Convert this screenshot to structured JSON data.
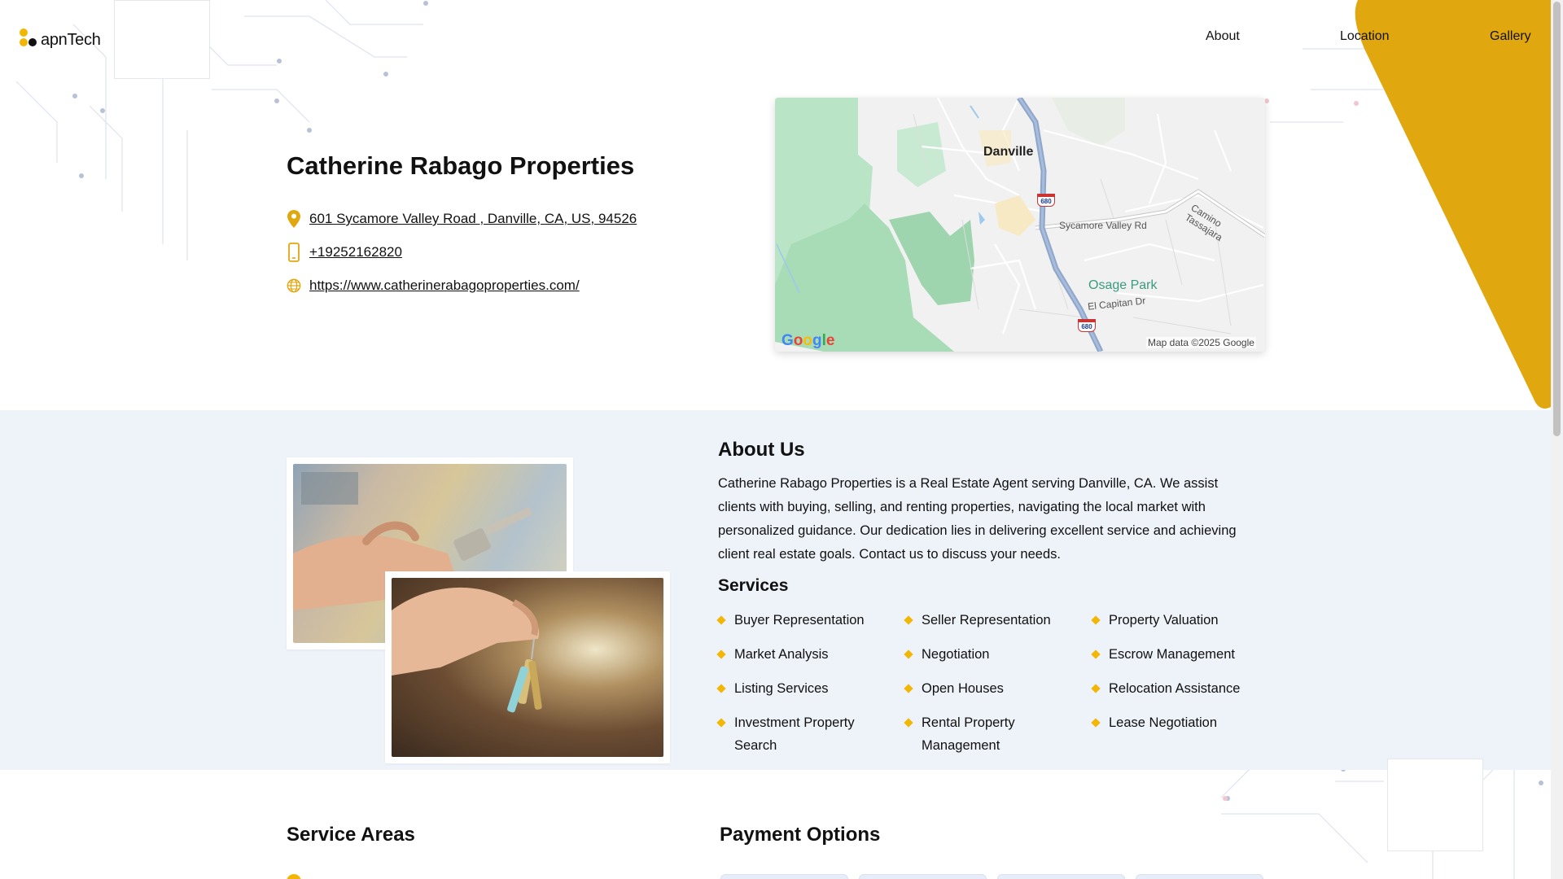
{
  "brand": {
    "name": "apnTech",
    "accent_color": "#f2b705"
  },
  "nav": {
    "about": "About",
    "location": "Location",
    "gallery": "Gallery"
  },
  "business": {
    "name": "Catherine Rabago Properties",
    "address": "601 Sycamore Valley Road , Danville, CA, US, 94526",
    "phone": "+19252162820",
    "website": "https://www.catherinerabagoproperties.com/",
    "icons": [
      "map-pin-icon",
      "phone-icon",
      "globe-icon"
    ]
  },
  "map": {
    "labels": {
      "city": "Danville",
      "road_1": "Sycamore Valley Rd",
      "road_2": "Camino Tassajara",
      "park": "Osage Park",
      "road_3": "El Capitan Dr",
      "highway": "680"
    },
    "attribution": "Map data ©2025 Google",
    "logo_letters": [
      "G",
      "o",
      "o",
      "g",
      "l",
      "e"
    ]
  },
  "about": {
    "title": "About Us",
    "text": "Catherine Rabago Properties is a Real Estate Agent serving Danville, CA. We assist clients with buying, selling, and renting properties, navigating the local market with personalized guidance. Our dedication lies in delivering excellent service and achieving client real estate goals. Contact us to discuss your needs."
  },
  "services": {
    "title": "Services",
    "items": [
      "Buyer Representation",
      "Seller Representation",
      "Property Valuation",
      "Market Analysis",
      "Negotiation",
      "Escrow Management",
      "Listing Services",
      "Open Houses",
      "Relocation Assistance",
      "Investment Property Search",
      "Rental Property Management",
      "Lease Negotiation"
    ]
  },
  "service_areas": {
    "title": "Service Areas"
  },
  "payment": {
    "title": "Payment Options"
  },
  "colors": {
    "gold": "#e0a70f",
    "band": "#eef2f9",
    "map_green": "#b8e6c6"
  }
}
